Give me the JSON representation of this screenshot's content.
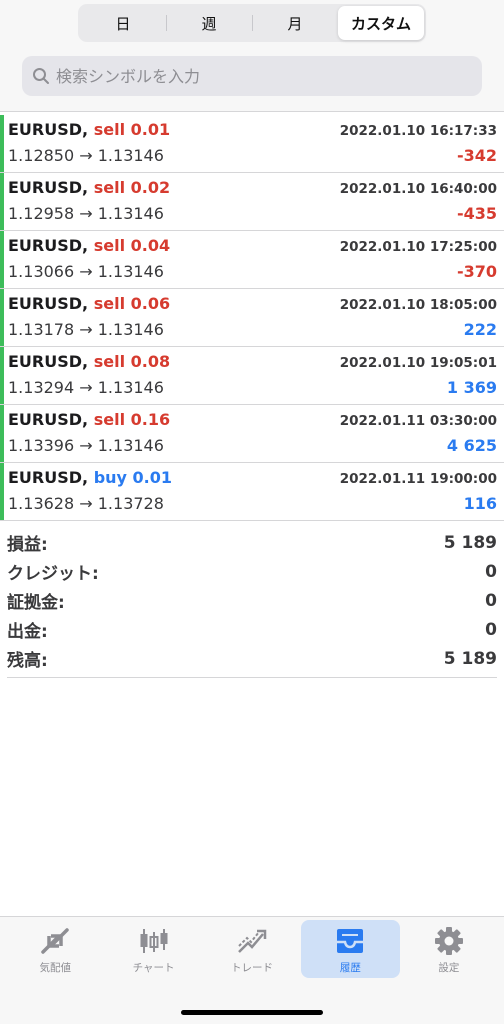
{
  "period_tabs": [
    {
      "label": "日",
      "active": false
    },
    {
      "label": "週",
      "active": false
    },
    {
      "label": "月",
      "active": false
    },
    {
      "label": "カスタム",
      "active": true
    }
  ],
  "search": {
    "placeholder": "検索シンボルを入力"
  },
  "deals": [
    {
      "symbol": "EURUSD,",
      "type": "sell 0.01",
      "side": "sell",
      "time": "2022.01.10 16:17:33",
      "prices": "1.12850 → 1.13146",
      "profit": "-342"
    },
    {
      "symbol": "EURUSD,",
      "type": "sell 0.02",
      "side": "sell",
      "time": "2022.01.10 16:40:00",
      "prices": "1.12958 → 1.13146",
      "profit": "-435"
    },
    {
      "symbol": "EURUSD,",
      "type": "sell 0.04",
      "side": "sell",
      "time": "2022.01.10 17:25:00",
      "prices": "1.13066 → 1.13146",
      "profit": "-370"
    },
    {
      "symbol": "EURUSD,",
      "type": "sell 0.06",
      "side": "sell",
      "time": "2022.01.10 18:05:00",
      "prices": "1.13178 → 1.13146",
      "profit": "222"
    },
    {
      "symbol": "EURUSD,",
      "type": "sell 0.08",
      "side": "sell",
      "time": "2022.01.10 19:05:01",
      "prices": "1.13294 → 1.13146",
      "profit": "1 369"
    },
    {
      "symbol": "EURUSD,",
      "type": "sell 0.16",
      "side": "sell",
      "time": "2022.01.11 03:30:00",
      "prices": "1.13396 → 1.13146",
      "profit": "4 625"
    },
    {
      "symbol": "EURUSD,",
      "type": "buy 0.01",
      "side": "buy",
      "time": "2022.01.11 19:00:00",
      "prices": "1.13628 → 1.13728",
      "profit": "116"
    }
  ],
  "summary": [
    {
      "label": "損益:",
      "value": "5 189"
    },
    {
      "label": "クレジット:",
      "value": "0"
    },
    {
      "label": "証拠金:",
      "value": "0"
    },
    {
      "label": "出金:",
      "value": "0"
    },
    {
      "label": "残高:",
      "value": "5 189"
    }
  ],
  "tabbar": [
    {
      "label": "気配値",
      "icon": "quotes-icon",
      "active": false
    },
    {
      "label": "チャート",
      "icon": "chart-icon",
      "active": false
    },
    {
      "label": "トレード",
      "icon": "trade-icon",
      "active": false
    },
    {
      "label": "履歴",
      "icon": "history-icon",
      "active": true
    },
    {
      "label": "設定",
      "icon": "settings-icon",
      "active": false
    }
  ],
  "colors": {
    "sell": "#d63b2f",
    "buy": "#2a7bf0",
    "accent_bar": "#3dbd5a",
    "active_tab_bg": "#cfe0f7"
  }
}
